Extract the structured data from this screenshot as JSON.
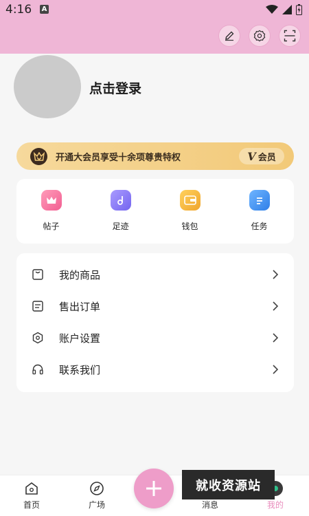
{
  "status_bar": {
    "time": "4:16",
    "notif_badge": "A"
  },
  "header": {
    "tools": [
      "edit-icon",
      "settings-icon",
      "scan-icon"
    ]
  },
  "profile": {
    "login_text": "点击登录"
  },
  "vip": {
    "text": "开通大会员享受十余项尊贵特权",
    "badge_letter": "V",
    "badge_label": "会员"
  },
  "shortcuts": [
    {
      "label": "帖子",
      "icon": "crown-icon",
      "color": "#f36b9c"
    },
    {
      "label": "足迹",
      "icon": "music-icon",
      "color": "#8b7cf6"
    },
    {
      "label": "钱包",
      "icon": "wallet-icon",
      "color": "#f3b33a"
    },
    {
      "label": "任务",
      "icon": "task-icon",
      "color": "#3b8ef2"
    }
  ],
  "menu": [
    {
      "label": "我的商品",
      "icon": "goods-icon"
    },
    {
      "label": "售出订单",
      "icon": "order-icon"
    },
    {
      "label": "账户设置",
      "icon": "account-settings-icon"
    },
    {
      "label": "联系我们",
      "icon": "headset-icon"
    }
  ],
  "bottom_nav": [
    {
      "label": "首页",
      "icon": "home-icon"
    },
    {
      "label": "广场",
      "icon": "compass-icon"
    },
    {
      "label": "消息",
      "icon": "message-icon"
    },
    {
      "label": "我的",
      "icon": "mine-icon"
    }
  ],
  "watermark": "就收资源站",
  "colors": {
    "header_bg": "#efb6d6",
    "fab": "#ee9dc9",
    "active_tab": "#e98dbd"
  }
}
